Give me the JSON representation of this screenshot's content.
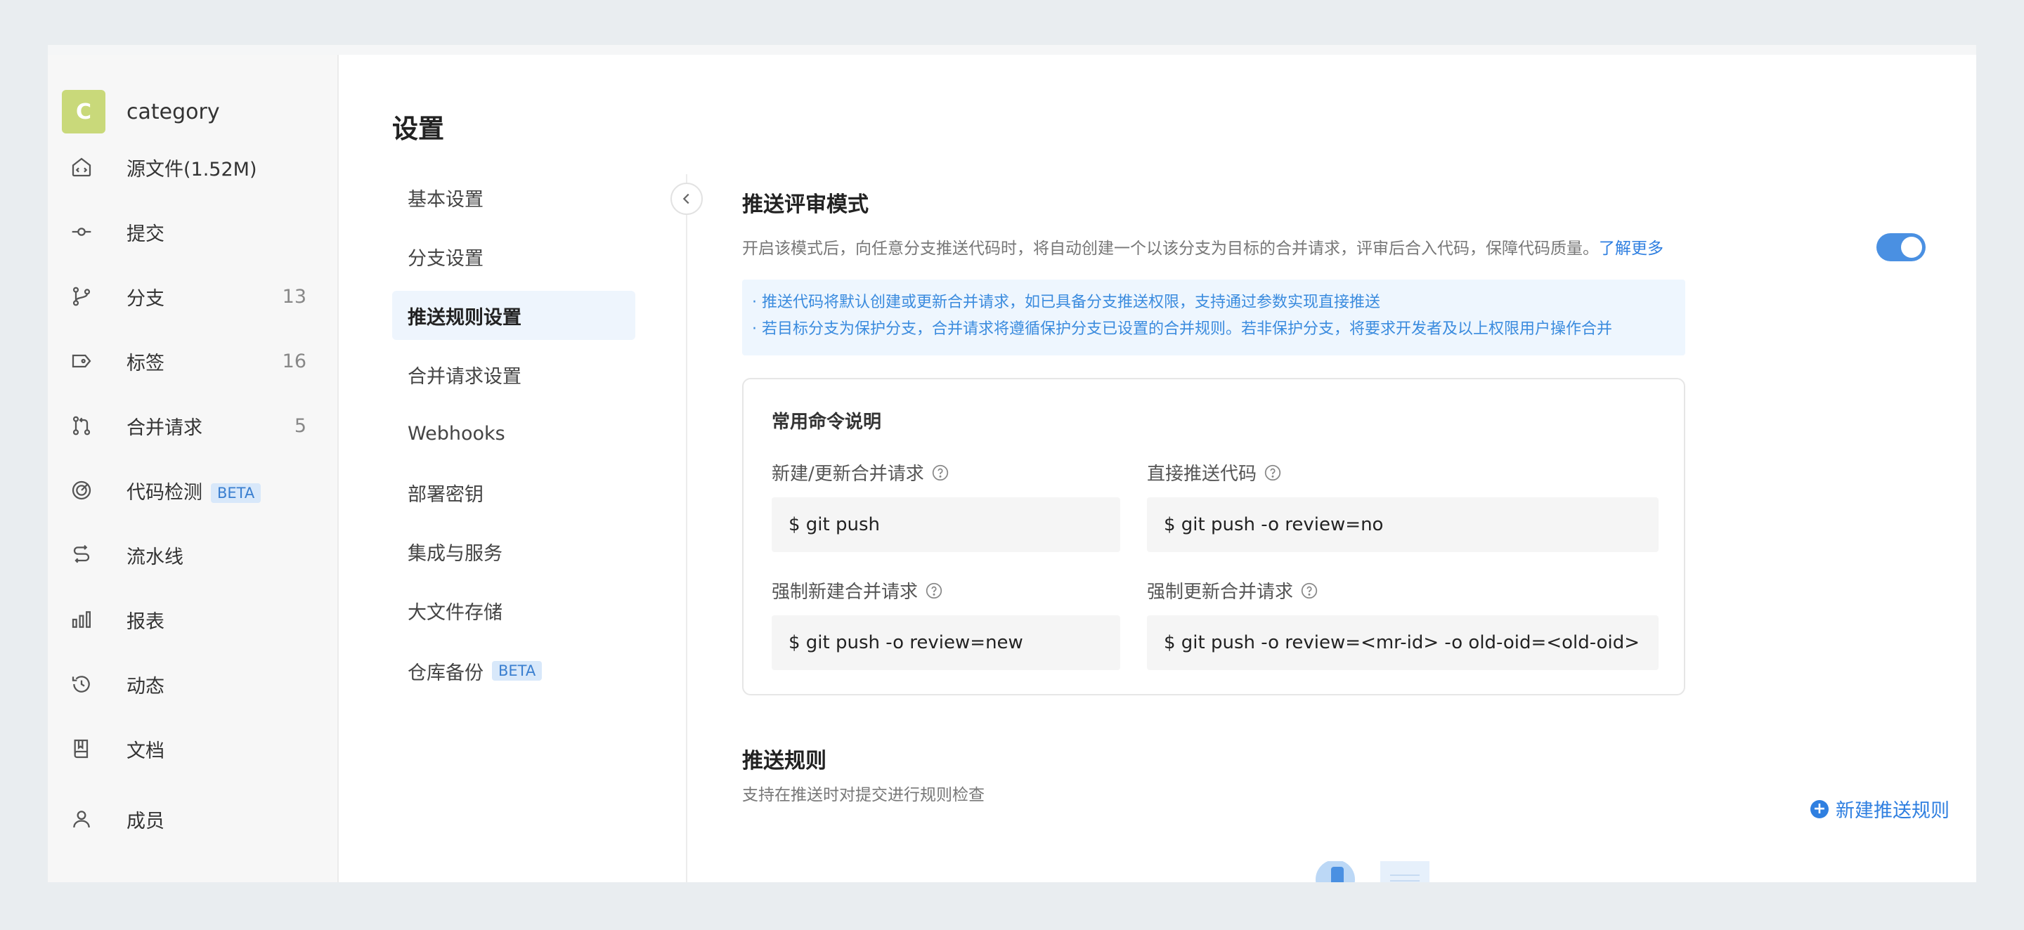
{
  "repo": {
    "avatar_letter": "C",
    "name": "category",
    "avatar_color": "#c9d97a"
  },
  "sidebar": {
    "items": [
      {
        "icon": "source-files-icon",
        "label": "源文件(1.52M)",
        "count": ""
      },
      {
        "icon": "commit-icon",
        "label": "提交",
        "count": ""
      },
      {
        "icon": "branch-icon",
        "label": "分支",
        "count": "13"
      },
      {
        "icon": "tag-icon",
        "label": "标签",
        "count": "16"
      },
      {
        "icon": "merge-request-icon",
        "label": "合并请求",
        "count": "5"
      },
      {
        "icon": "code-scan-icon",
        "label": "代码检测",
        "count": "",
        "badge": "BETA"
      },
      {
        "icon": "pipeline-icon",
        "label": "流水线",
        "count": ""
      },
      {
        "icon": "report-icon",
        "label": "报表",
        "count": ""
      },
      {
        "icon": "activity-icon",
        "label": "动态",
        "count": ""
      },
      {
        "icon": "docs-icon",
        "label": "文档",
        "count": ""
      },
      {
        "icon": "member-icon",
        "label": "成员",
        "count": ""
      }
    ]
  },
  "page": {
    "title": "设置"
  },
  "settings_menu": {
    "items": [
      {
        "label": "基本设置"
      },
      {
        "label": "分支设置"
      },
      {
        "label": "推送规则设置",
        "active": true
      },
      {
        "label": "合并请求设置"
      },
      {
        "label": "Webhooks"
      },
      {
        "label": "部署密钥"
      },
      {
        "label": "集成与服务"
      },
      {
        "label": "大文件存储"
      },
      {
        "label": "仓库备份",
        "badge": "BETA"
      }
    ]
  },
  "push_review": {
    "title": "推送评审模式",
    "description": "开启该模式后，向任意分支推送代码时，将自动创建一个以该分支为目标的合并请求，评审后合入代码，保障代码质量。",
    "learn_more": "了解更多",
    "enabled": true,
    "info_lines": [
      "· 推送代码将默认创建或更新合并请求，如已具备分支推送权限，支持通过参数实现直接推送",
      "· 若目标分支为保护分支，合并请求将遵循保护分支已设置的合并规则。若非保护分支，将要求开发者及以上权限用户操作合并"
    ]
  },
  "commands": {
    "title": "常用命令说明",
    "items": [
      {
        "label": "新建/更新合并请求",
        "command": "$ git push"
      },
      {
        "label": "直接推送代码",
        "command": "$ git push -o review=no"
      },
      {
        "label": "强制新建合并请求",
        "command": "$ git push -o review=new"
      },
      {
        "label": "强制更新合并请求",
        "command": "$ git push -o review=<mr-id> -o old-oid=<old-oid>"
      }
    ]
  },
  "push_rules": {
    "title": "推送规则",
    "description": "支持在推送时对提交进行规则检查",
    "new_button": "新建推送规则"
  },
  "colors": {
    "accent": "#2f7fe0",
    "toggle_on": "#4a90e2",
    "info_bg": "#eef6fe",
    "beta_bg": "#d8e8fa"
  }
}
